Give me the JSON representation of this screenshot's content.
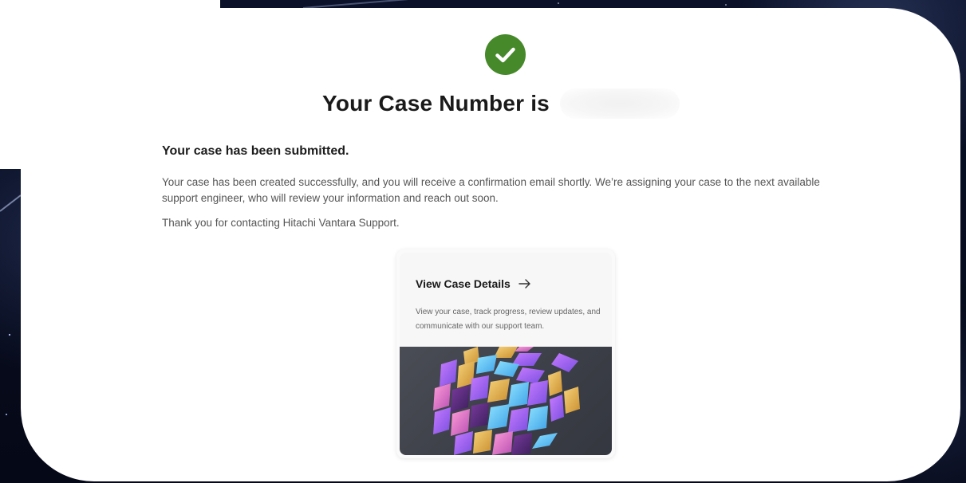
{
  "confirmation": {
    "title": "Your Case Number is",
    "heading": "Your case has been submitted.",
    "body": "Your case has been created successfully, and you will receive a confirmation email shortly. We’re assigning your case to the next available support engineer, who will review your information and reach out soon.",
    "thanks": "Thank you for contacting Hitachi Vantara Support."
  },
  "case_card": {
    "title": "View Case Details",
    "description": "View your case, track progress, review updates, and communicate with our support team.",
    "icon": "arrow-right-icon",
    "image": "abstract-cubes-illustration"
  },
  "icons": {
    "success": "check-circle-icon"
  },
  "colors": {
    "success_green": "#46892a",
    "card_image_bg": "#43464e",
    "page_background": "#070b1c"
  }
}
